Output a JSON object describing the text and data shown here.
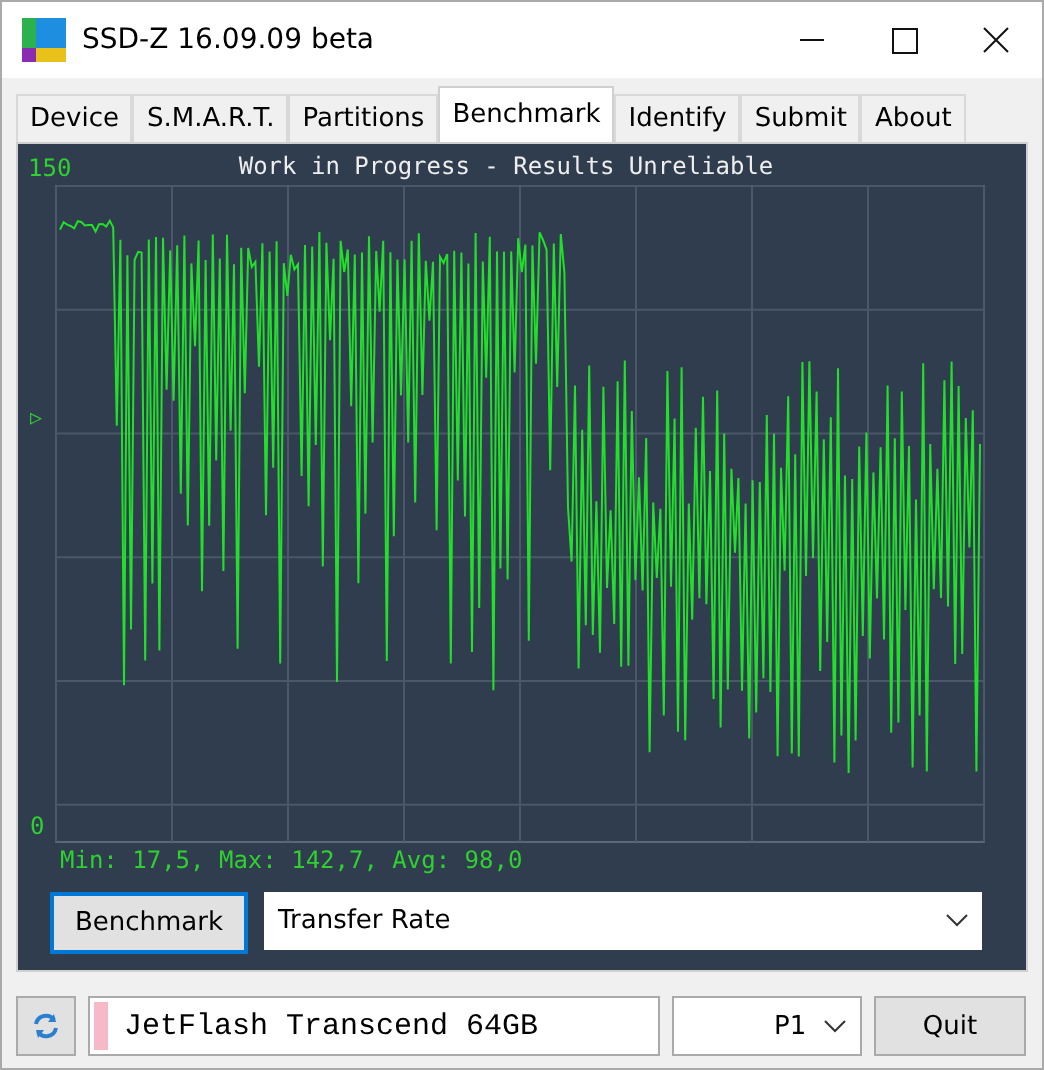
{
  "window": {
    "title": "SSD-Z 16.09.09 beta"
  },
  "tabs": [
    {
      "label": "Device",
      "selected": false
    },
    {
      "label": "S.M.A.R.T.",
      "selected": false
    },
    {
      "label": "Partitions",
      "selected": false
    },
    {
      "label": "Benchmark",
      "selected": true
    },
    {
      "label": "Identify",
      "selected": false
    },
    {
      "label": "Submit",
      "selected": false
    },
    {
      "label": "About",
      "selected": false
    }
  ],
  "graph": {
    "title": "Work in Progress - Results Unreliable",
    "top_label": "150",
    "bottom_label": "0",
    "marker": "▷",
    "stats": "Min: 17,5, Max: 142,7, Avg: 98,0"
  },
  "benchmark_button": "Benchmark",
  "mode_select": {
    "value": "Transfer Rate"
  },
  "drive_select": {
    "value": "JetFlash Transcend 64GB"
  },
  "partition_select": {
    "value": "P1"
  },
  "quit_button": "Quit"
}
